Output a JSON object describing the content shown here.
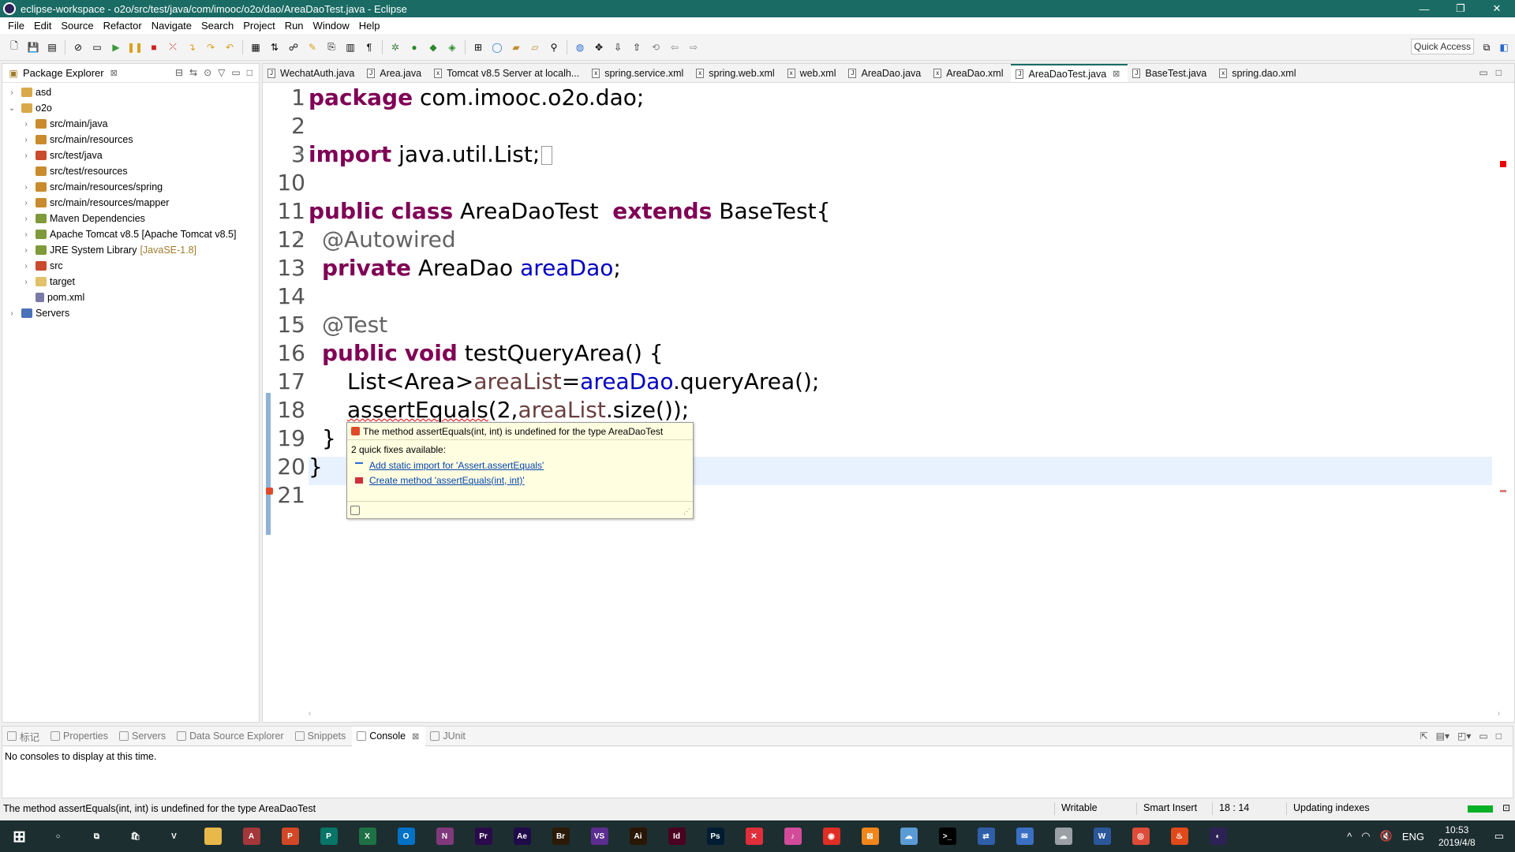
{
  "window": {
    "title": "eclipse-workspace - o2o/src/test/java/com/imooc/o2o/dao/AreaDaoTest.java - Eclipse",
    "min_glyph": "—",
    "max_glyph": "❐",
    "close_glyph": "✕"
  },
  "menu": [
    "File",
    "Edit",
    "Source",
    "Refactor",
    "Navigate",
    "Search",
    "Project",
    "Run",
    "Window",
    "Help"
  ],
  "toolbar": {
    "quick_access": "Quick Access"
  },
  "package_explorer": {
    "title": "Package Explorer",
    "close_glyph": "⊠",
    "items": [
      {
        "label": "asd",
        "decor": "",
        "icon": "project-icon",
        "expanded": false
      },
      {
        "label": "o2o",
        "decor": "",
        "icon": "project-icon",
        "expanded": true
      },
      {
        "label": "src/main/java",
        "decor": "",
        "icon": "source-folder-icon"
      },
      {
        "label": "src/main/resources",
        "decor": "",
        "icon": "source-folder-icon"
      },
      {
        "label": "src/test/java",
        "decor": "",
        "icon": "source-folder-error-icon"
      },
      {
        "label": "src/test/resources",
        "decor": "",
        "icon": "source-folder-icon"
      },
      {
        "label": "src/main/resources/spring",
        "decor": "",
        "icon": "source-folder-icon"
      },
      {
        "label": "src/main/resources/mapper",
        "decor": "",
        "icon": "source-folder-icon"
      },
      {
        "label": "Maven Dependencies",
        "decor": "",
        "icon": "library-icon"
      },
      {
        "label": "Apache Tomcat v8.5 [Apache Tomcat v8.5]",
        "decor": "",
        "icon": "library-icon"
      },
      {
        "label": "JRE System Library",
        "decor": "[JavaSE-1.8]",
        "icon": "library-icon"
      },
      {
        "label": "src",
        "decor": "",
        "icon": "folder-error-icon"
      },
      {
        "label": "target",
        "decor": "",
        "icon": "folder-icon"
      },
      {
        "label": "pom.xml",
        "decor": "",
        "icon": "xml-file-icon"
      },
      {
        "label": "Servers",
        "decor": "",
        "icon": "servers-icon"
      }
    ]
  },
  "editor": {
    "tabs": [
      {
        "label": "WechatAuth.java",
        "active": false
      },
      {
        "label": "Area.java",
        "active": false
      },
      {
        "label": "Tomcat v8.5 Server at localh...",
        "active": false
      },
      {
        "label": "spring.service.xml",
        "active": false
      },
      {
        "label": "spring.web.xml",
        "active": false
      },
      {
        "label": "web.xml",
        "active": false
      },
      {
        "label": "AreaDao.java",
        "active": false
      },
      {
        "label": "AreaDao.xml",
        "active": false
      },
      {
        "label": "AreaDaoTest.java",
        "active": true
      },
      {
        "label": "BaseTest.java",
        "active": false
      },
      {
        "label": "spring.dao.xml",
        "active": false
      }
    ],
    "line_numbers": [
      "1",
      "2",
      "3",
      "10",
      "11",
      "12",
      "13",
      "14",
      "15",
      "16",
      "17",
      "18",
      "19",
      "20",
      "21"
    ],
    "code": {
      "l1_kw": "package",
      "l1_rest": " com.imooc.o2o.dao;",
      "l3_kw": "import",
      "l3_rest": " java.util.List;",
      "l11_kw1": "public",
      "l11_kw2": "class",
      "l11_name": " AreaDaoTest  ",
      "l11_kw3": "extends",
      "l11_rest": " BaseTest{",
      "l12_ann": "@Autowired",
      "l13_kw": "private",
      "l13_type": " AreaDao ",
      "l13_fld": "areaDao",
      "l13_end": ";",
      "l15_ann": "@Test",
      "l16_kw1": "public",
      "l16_kw2": "void",
      "l16_rest": " testQueryArea() {",
      "l17_type": "List<Area>",
      "l17_var": "areaList",
      "l17_eq": "=",
      "l17_fld": "areaDao",
      "l17_rest": ".queryArea();",
      "l18_err": "assertEquals",
      "l18_mid": "(2,",
      "l18_var": "areaList",
      "l18_rest": ".size());",
      "l19": "}",
      "l20": "}"
    }
  },
  "hover": {
    "message": "The method assertEquals(int, int) is undefined for the type AreaDaoTest",
    "fix_count": "2 quick fixes available:",
    "fixes": [
      "Add static import for 'Assert.assertEquals'",
      "Create method 'assertEquals(int, int)'"
    ]
  },
  "bottom_panel": {
    "tabs": [
      {
        "label": "标记",
        "active": false
      },
      {
        "label": "Properties",
        "active": false
      },
      {
        "label": "Servers",
        "active": false
      },
      {
        "label": "Data Source Explorer",
        "active": false
      },
      {
        "label": "Snippets",
        "active": false
      },
      {
        "label": "Console",
        "active": true
      },
      {
        "label": "JUnit",
        "active": false
      }
    ],
    "console_message": "No consoles to display at this time."
  },
  "status": {
    "message": "The method assertEquals(int, int) is undefined for the type AreaDaoTest",
    "mode": "Writable",
    "insert": "Smart Insert",
    "position": "18 : 14",
    "task": "Updating indexes"
  },
  "taskbar": {
    "apps": [
      {
        "name": "search-icon",
        "label": "○",
        "color": "#1d2e30"
      },
      {
        "name": "task-view-icon",
        "label": "⧉",
        "color": "#1d2e30"
      },
      {
        "name": "store-icon",
        "label": "🛍",
        "color": "#1d2e30"
      },
      {
        "name": "shield-app-icon",
        "label": "V",
        "color": "#1d2e30"
      },
      {
        "name": "file-explorer-icon",
        "label": "",
        "color": "#e8b84a"
      },
      {
        "name": "access-icon",
        "label": "A",
        "color": "#a4373a"
      },
      {
        "name": "powerpoint-icon",
        "label": "P",
        "color": "#d24726"
      },
      {
        "name": "publisher-icon",
        "label": "P",
        "color": "#077568"
      },
      {
        "name": "excel-icon",
        "label": "X",
        "color": "#1e7145"
      },
      {
        "name": "outlook-icon",
        "label": "O",
        "color": "#0072c6"
      },
      {
        "name": "onenote-icon",
        "label": "N",
        "color": "#80397b"
      },
      {
        "name": "premiere-icon",
        "label": "Pr",
        "color": "#2a0a4a"
      },
      {
        "name": "after-effects-icon",
        "label": "Ae",
        "color": "#1f0a4a"
      },
      {
        "name": "bridge-icon",
        "label": "Br",
        "color": "#2a1a08"
      },
      {
        "name": "visual-studio-icon",
        "label": "VS",
        "color": "#5c2d91"
      },
      {
        "name": "illustrator-icon",
        "label": "Ai",
        "color": "#2a1605"
      },
      {
        "name": "indesign-icon",
        "label": "Id",
        "color": "#49021f"
      },
      {
        "name": "photoshop-icon",
        "label": "Ps",
        "color": "#001d34"
      },
      {
        "name": "xmind-icon",
        "label": "✕",
        "color": "#e02e3a"
      },
      {
        "name": "itunes-icon",
        "label": "♪",
        "color": "#d24b9a"
      },
      {
        "name": "netease-music-icon",
        "label": "◉",
        "color": "#e02e24"
      },
      {
        "name": "xampp-icon",
        "label": "⊠",
        "color": "#f0861a"
      },
      {
        "name": "cloud-drive-icon",
        "label": "☁",
        "color": "#5a9bd5"
      },
      {
        "name": "terminal-icon",
        "label": ">_",
        "color": "#000000"
      },
      {
        "name": "network-app-icon",
        "label": "⇄",
        "color": "#2f5fa8"
      },
      {
        "name": "mail-app-icon",
        "label": "✉",
        "color": "#3a6fc4"
      },
      {
        "name": "cloud-app-icon",
        "label": "☁",
        "color": "#9aa0a6"
      },
      {
        "name": "word-icon",
        "label": "W",
        "color": "#2b579a"
      },
      {
        "name": "chrome-icon",
        "label": "◎",
        "color": "#dd4b39"
      },
      {
        "name": "flame-app-icon",
        "label": "♨",
        "color": "#e04a1a"
      },
      {
        "name": "eclipse-icon",
        "label": "◐",
        "color": "#2c2255"
      }
    ],
    "lang": "ENG",
    "time": "10:53",
    "date": "2019/4/8"
  }
}
